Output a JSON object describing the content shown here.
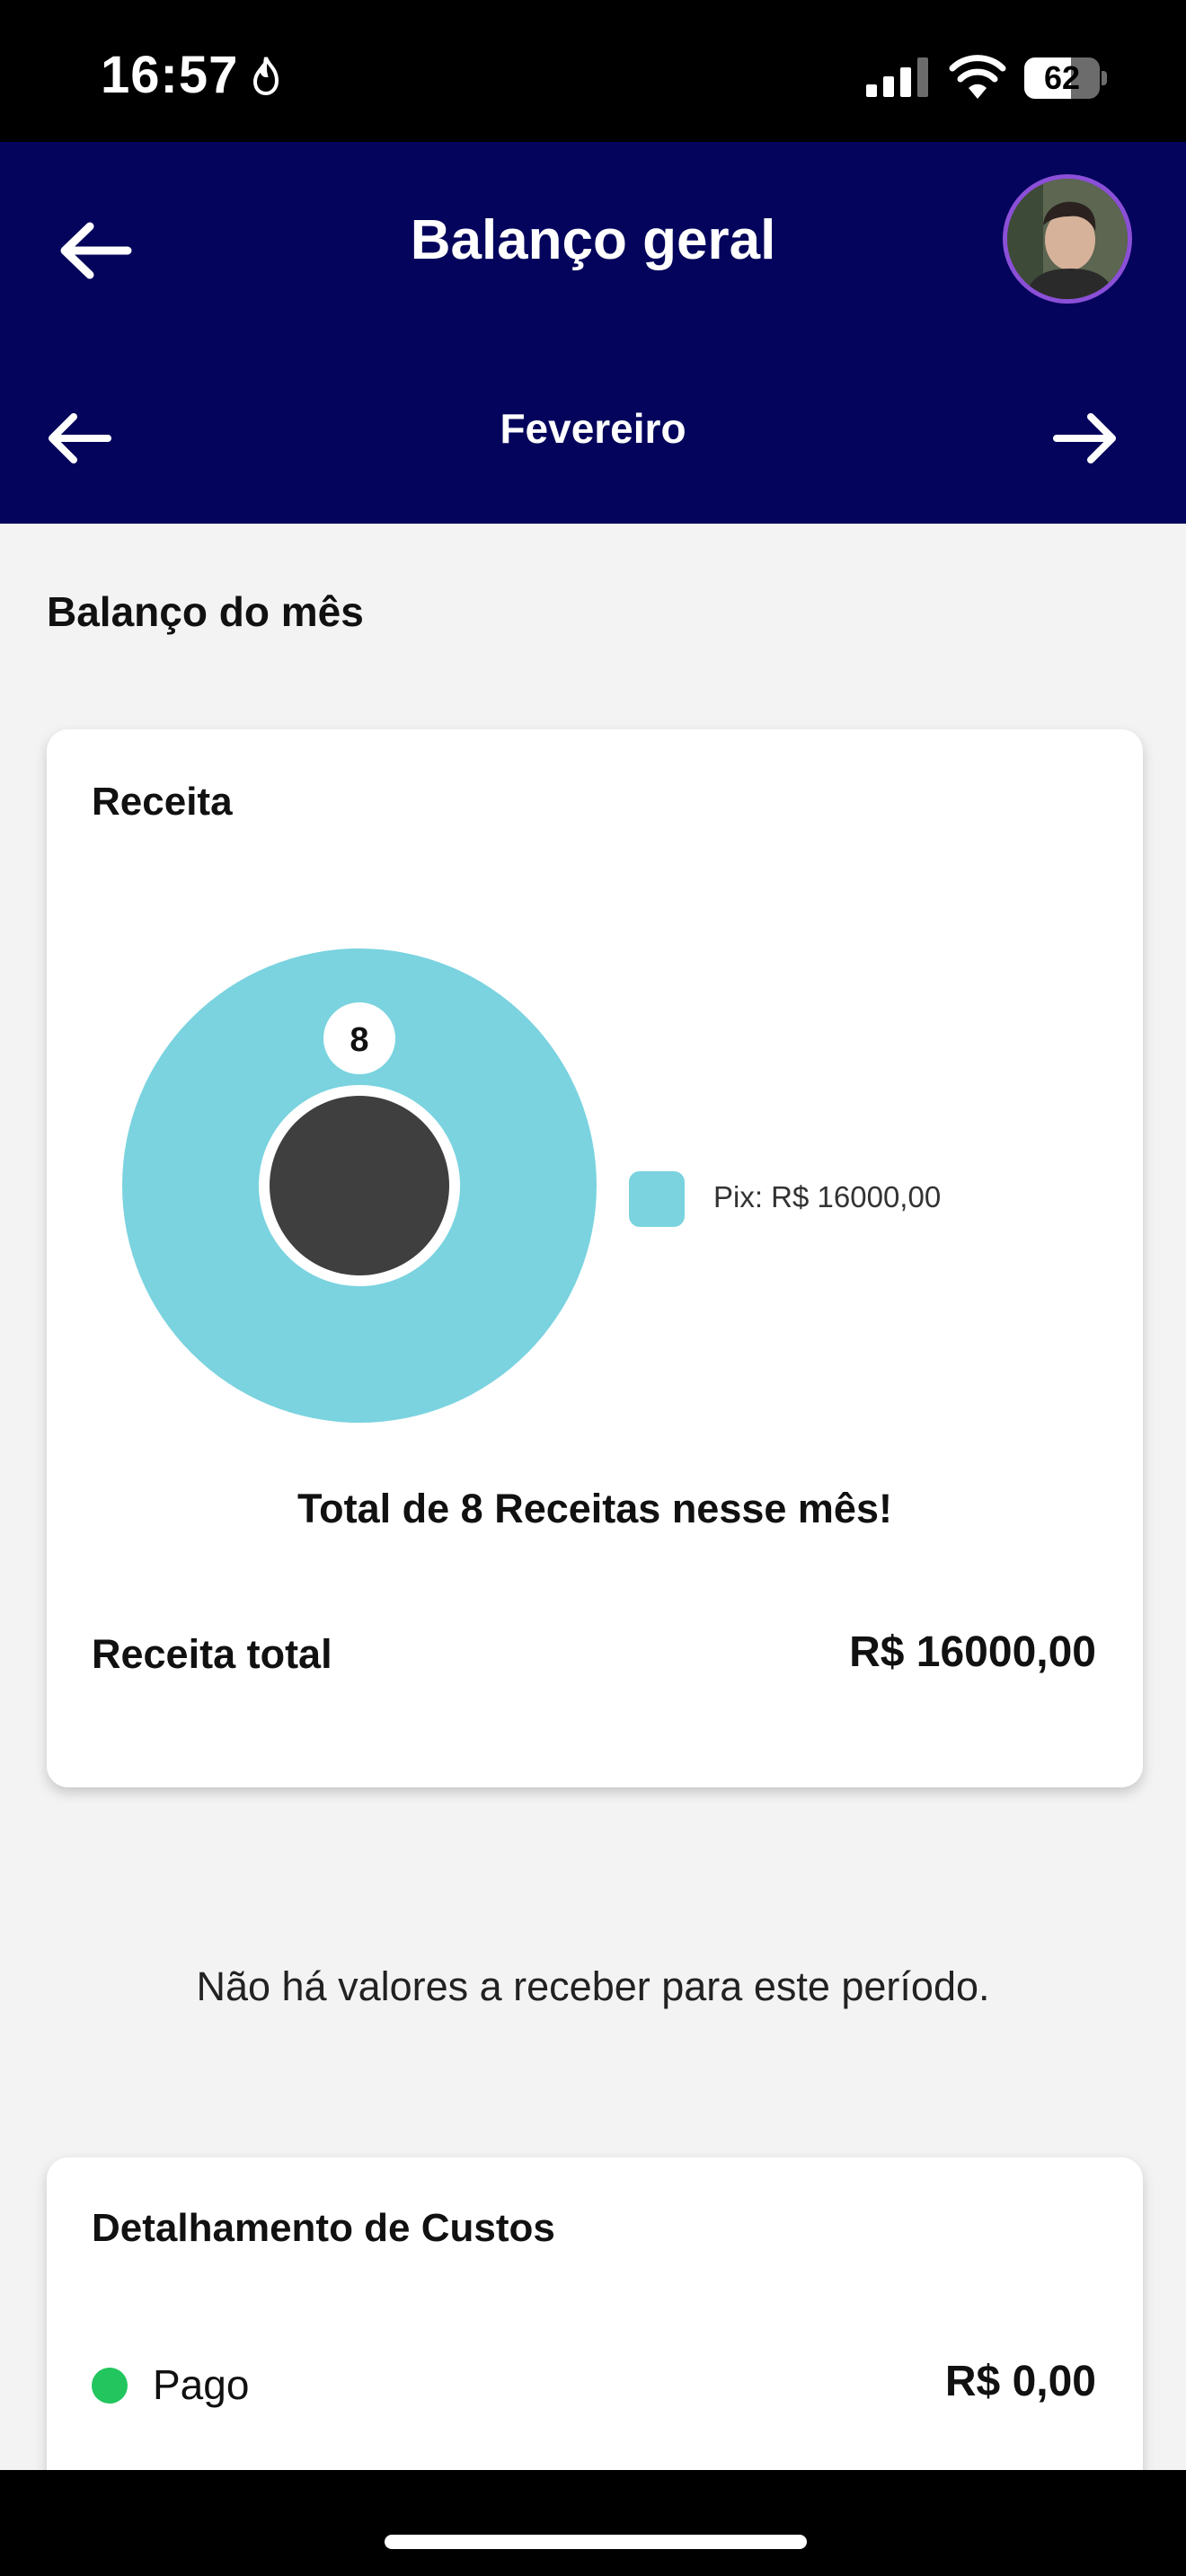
{
  "status_bar": {
    "time": "16:57",
    "battery": "62",
    "battery_level": 0.62
  },
  "header": {
    "title": "Balanço geral",
    "month": "Fevereiro"
  },
  "section_title": "Balanço do mês",
  "receita_card": {
    "title": "Receita",
    "total_message": "Total de 8 Receitas nesse mês!",
    "total_label": "Receita total",
    "total_value": "R$ 16000,00"
  },
  "chart_data": {
    "type": "pie",
    "categories": [
      "Pix"
    ],
    "values": [
      16000
    ],
    "counts": [
      8
    ],
    "data_labels": [
      "8"
    ],
    "legend": [
      "Pix: R$ 16000,00"
    ],
    "legend_position": "right",
    "colors": [
      "#7ad3df"
    ]
  },
  "empty_receivables_message": "Não há valores a receber para este período.",
  "custos_card": {
    "title": "Detalhamento de Custos",
    "items": [
      {
        "label": "Pago",
        "value": "R$ 0,00",
        "color": "#22c55e"
      }
    ]
  },
  "icons": {
    "back": "arrow-left-icon",
    "prev_month": "arrow-left-icon",
    "next_month": "arrow-right-icon",
    "flame": "flame-icon",
    "signal": "cellular-signal-icon",
    "wifi": "wifi-icon",
    "battery": "battery-icon"
  }
}
